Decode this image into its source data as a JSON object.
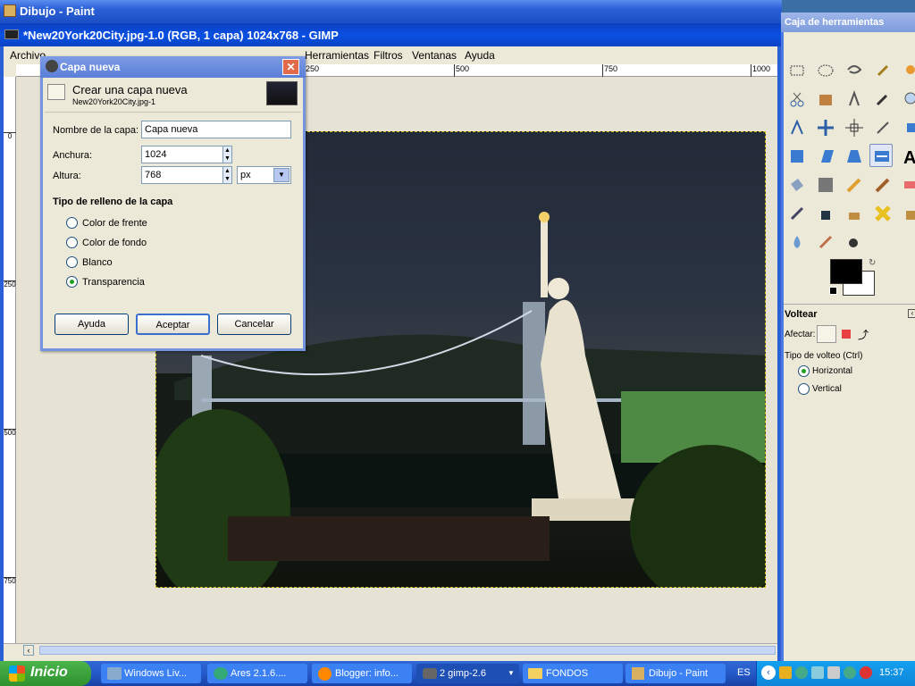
{
  "paint_window": {
    "title": "Dibujo - Paint"
  },
  "gimp_window": {
    "title": "*New20York20City.jpg-1.0 (RGB, 1 capa) 1024x768 - GIMP",
    "menu": [
      "Archivo",
      "Herramientas",
      "Filtros",
      "Ventanas",
      "Ayuda"
    ],
    "ruler_h": [
      "250",
      "500",
      "750",
      "1000"
    ],
    "ruler_v": [
      "0",
      "250",
      "500",
      "750"
    ]
  },
  "toolbox": {
    "title": "Caja de herramientas",
    "tool_options_title": "Voltear",
    "affect_label": "Afectar:",
    "flip_type_label": "Tipo de volteo  (Ctrl)",
    "flip_options": [
      {
        "label": "Horizontal",
        "selected": true
      },
      {
        "label": "Vertical",
        "selected": false
      }
    ],
    "fg_color": "#000000",
    "bg_color": "#ffffff"
  },
  "dialog": {
    "title": "Capa nueva",
    "heading": "Crear una capa nueva",
    "subheading": "New20York20City.jpg-1",
    "name_label": "Nombre de la capa:",
    "name_value": "Capa nueva",
    "width_label": "Anchura:",
    "width_value": "1024",
    "height_label": "Altura:",
    "height_value": "768",
    "unit_value": "px",
    "fill_heading": "Tipo de relleno de la capa",
    "fill_options": [
      {
        "label": "Color de frente",
        "selected": false
      },
      {
        "label": "Color de fondo",
        "selected": false
      },
      {
        "label": "Blanco",
        "selected": false
      },
      {
        "label": "Transparencia",
        "selected": true
      }
    ],
    "buttons": {
      "help": "Ayuda",
      "ok": "Aceptar",
      "cancel": "Cancelar"
    }
  },
  "taskbar": {
    "start": "Inicio",
    "tasks": [
      {
        "label": "Windows Liv..."
      },
      {
        "label": "Ares 2.1.6...."
      },
      {
        "label": "Blogger: info..."
      },
      {
        "label": "2 gimp-2.6"
      },
      {
        "label": "FONDOS"
      },
      {
        "label": "Dibujo - Paint"
      }
    ],
    "language": "ES",
    "clock": "15:37"
  }
}
